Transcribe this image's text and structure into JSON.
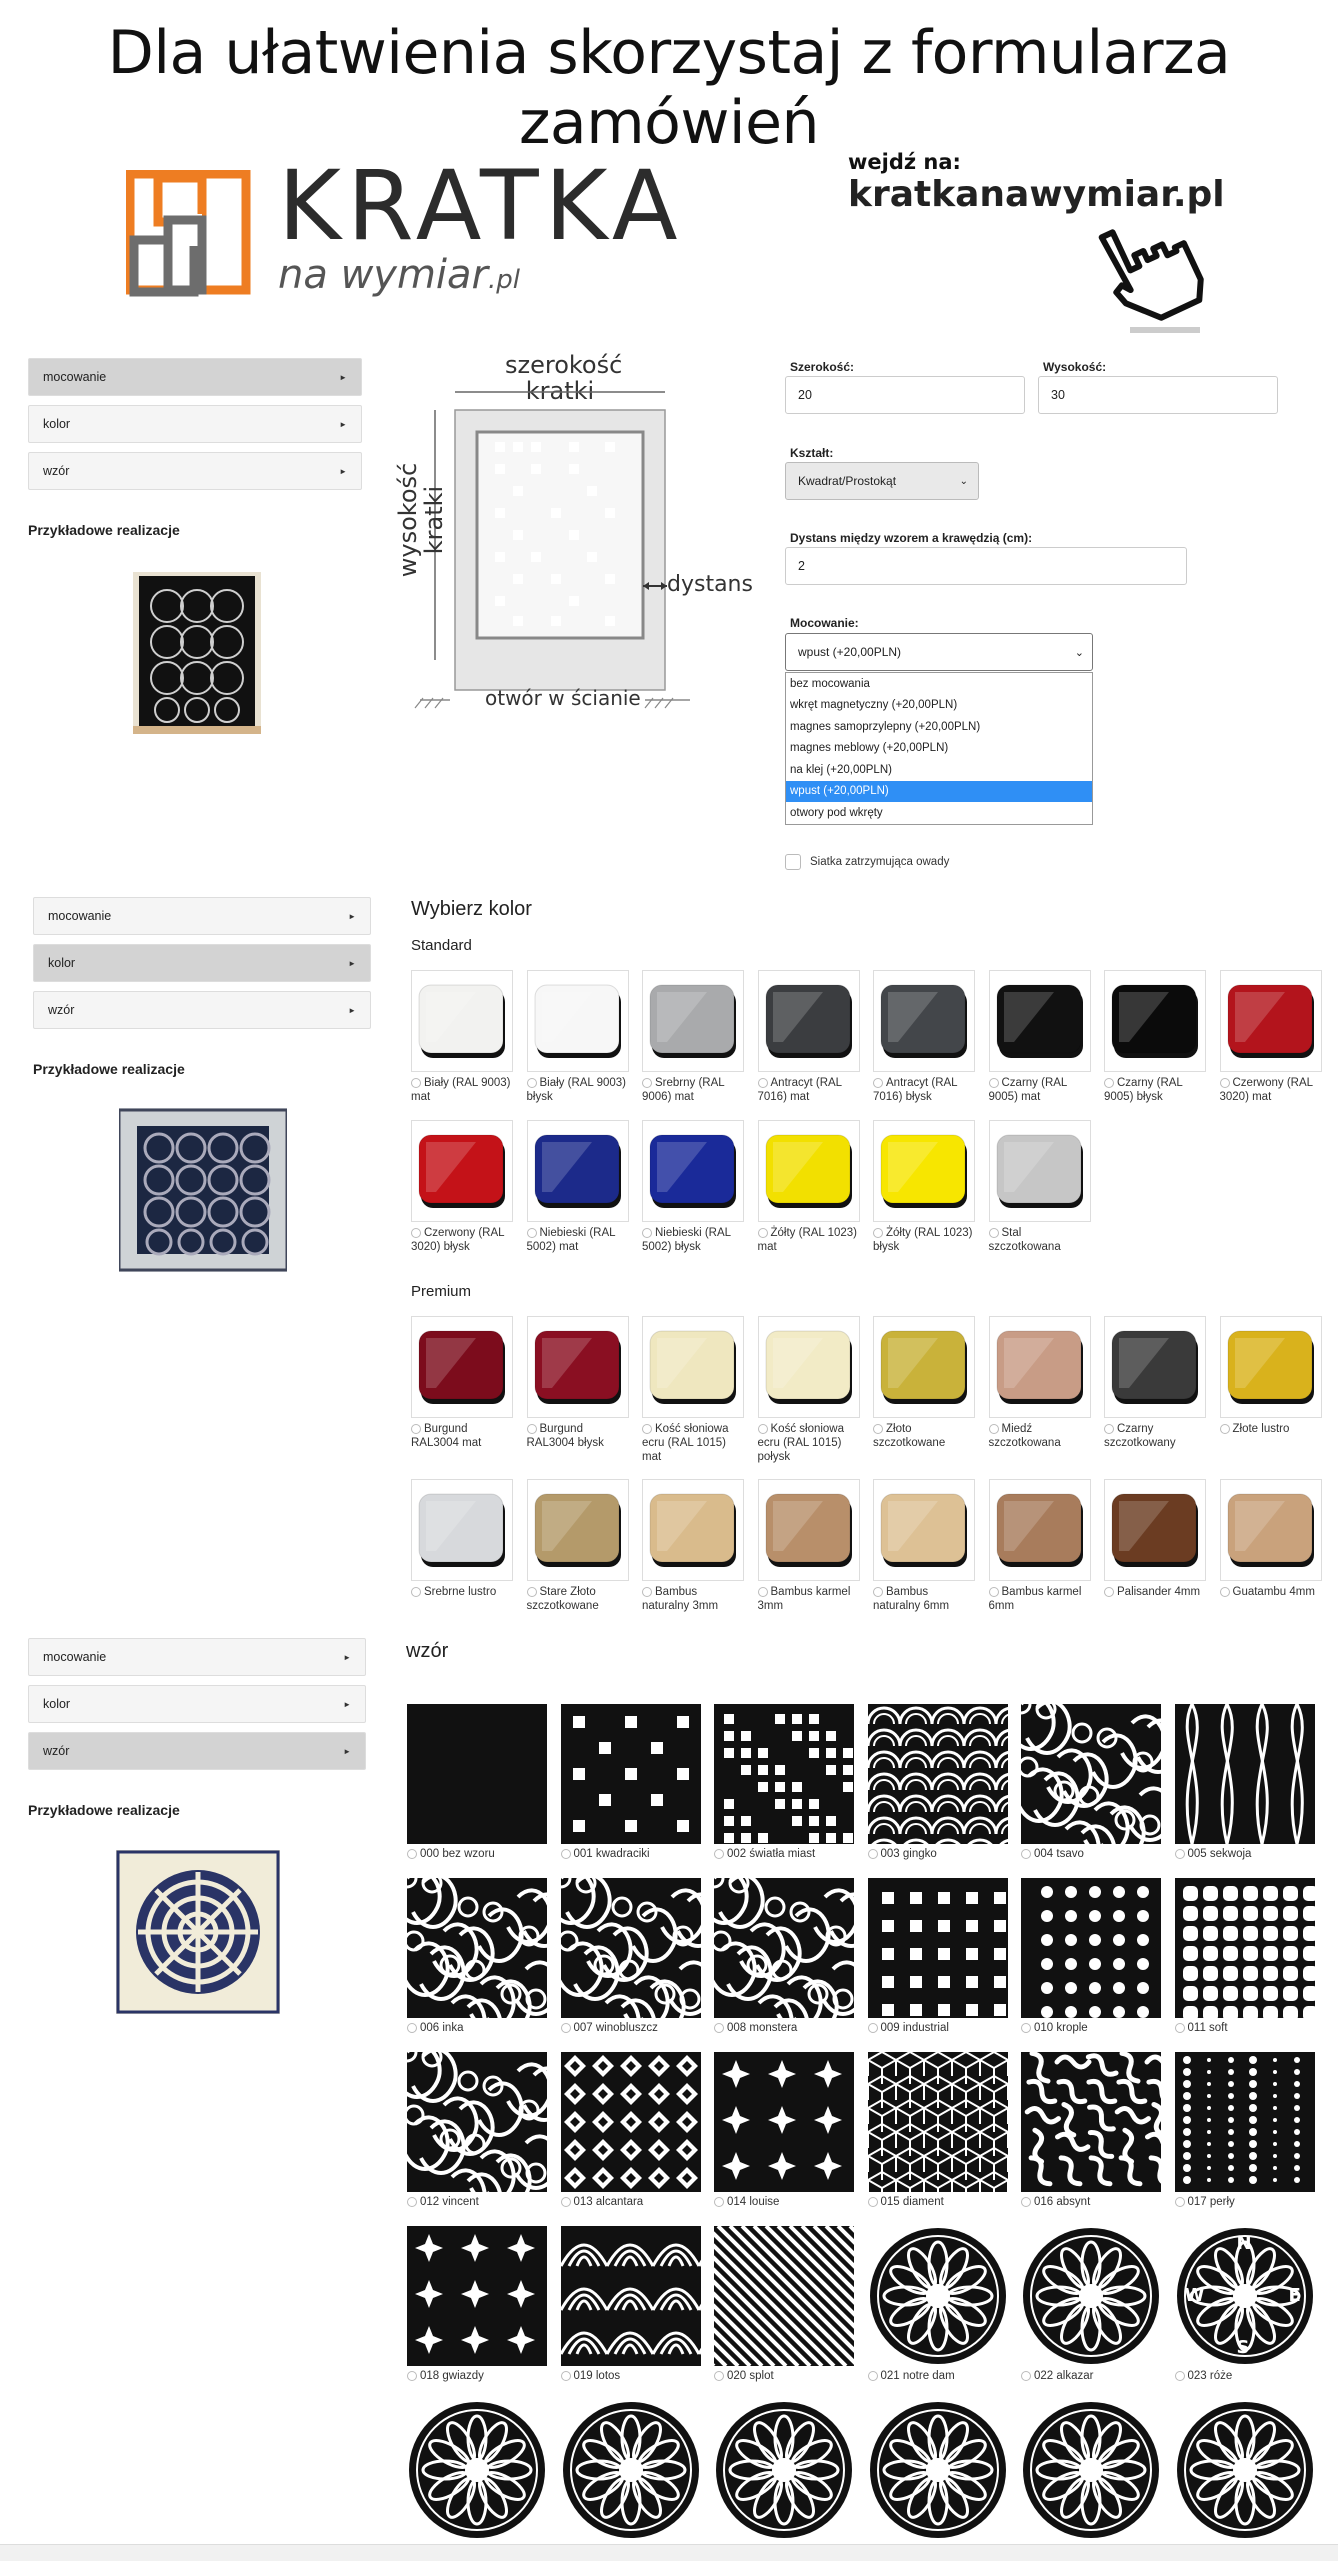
{
  "headline": "Dla ułatwienia skorzystaj z formularza zamówień",
  "logo": {
    "main": "KRATKA",
    "sub": "na wymiar",
    "tld": ".pl"
  },
  "promo": {
    "small": "wejdź na:",
    "domain": "kratkanawymiar.pl"
  },
  "sidebar": {
    "items": [
      "mocowanie",
      "kolor",
      "wzór"
    ],
    "heading": "Przykładowe realizacje"
  },
  "diagram": {
    "width_label_1": "szerokość",
    "width_label_2": "kratki",
    "height_label_1": "wysokość",
    "height_label_2": "kratki",
    "gap_label": "dystans",
    "wall_label": "otwór w ścianie"
  },
  "form": {
    "width_label": "Szerokość:",
    "width_value": "20",
    "height_label": "Wysokość:",
    "height_value": "30",
    "shape_label": "Kształt:",
    "shape_value": "Kwadrat/Prostokąt",
    "distance_label": "Dystans między wzorem a krawędzią (cm):",
    "distance_value": "2",
    "mount_label": "Mocowanie:",
    "mount_value": "wpust (+20,00PLN)",
    "mount_options": [
      "bez mocowania",
      "wkręt magnetyczny (+20,00PLN)",
      "magnes samoprzylepny (+20,00PLN)",
      "magnes meblowy (+20,00PLN)",
      "na klej (+20,00PLN)",
      "wpust (+20,00PLN)",
      "otwory pod wkręty"
    ],
    "mount_selected_index": 5,
    "net_label": "Siatka zatrzymująca owady"
  },
  "colors": {
    "title": "Wybierz kolor",
    "standard_title": "Standard",
    "premium_title": "Premium",
    "standard": [
      {
        "label": "Biały (RAL 9003) mat",
        "color": "#f2f2f0"
      },
      {
        "label": "Biały (RAL 9003) błysk",
        "color": "#f7f7f7"
      },
      {
        "label": "Srebrny (RAL 9006) mat",
        "color": "#a9aaac"
      },
      {
        "label": "Antracyt (RAL 7016) mat",
        "color": "#3b3d40"
      },
      {
        "label": "Antracyt (RAL 7016) błysk",
        "color": "#43464a"
      },
      {
        "label": "Czarny (RAL 9005) mat",
        "color": "#111111"
      },
      {
        "label": "Czarny (RAL 9005) błysk",
        "color": "#0b0b0b"
      },
      {
        "label": "Czerwony (RAL 3020) mat",
        "color": "#b3141c"
      },
      {
        "label": "Czerwony (RAL 3020) błysk",
        "color": "#c41218"
      },
      {
        "label": "Niebieski (RAL 5002) mat",
        "color": "#1c2a8a"
      },
      {
        "label": "Niebieski (RAL 5002) błysk",
        "color": "#1a2a99"
      },
      {
        "label": "Żółty (RAL 1023) mat",
        "color": "#f2e000"
      },
      {
        "label": "Żółty (RAL 1023) błysk",
        "color": "#f7e600"
      },
      {
        "label": "Stal szczotkowana",
        "color": "#c6c6c6"
      }
    ],
    "premium": [
      {
        "label": "Burgund RAL3004 mat",
        "color": "#7c0c1c"
      },
      {
        "label": "Burgund RAL3004 błysk",
        "color": "#8a0f22"
      },
      {
        "label": "Kość słoniowa ecru (RAL 1015) mat",
        "color": "#efe7bf"
      },
      {
        "label": "Kość słoniowa ecru (RAL 1015) połysk",
        "color": "#f2ebc6"
      },
      {
        "label": "Złoto szczotkowane",
        "color": "#c9b23a"
      },
      {
        "label": "Miedź szczotkowana",
        "color": "#c89c86"
      },
      {
        "label": "Czarny szczotkowany",
        "color": "#3a3a3a"
      },
      {
        "label": "Złote lustro",
        "color": "#d9b21c"
      },
      {
        "label": "Srebrne lustro",
        "color": "#d7d9dc"
      },
      {
        "label": "Stare Złoto szczotkowane",
        "color": "#b49a6a"
      },
      {
        "label": "Bambus naturalny 3mm",
        "color": "#d9bb8c"
      },
      {
        "label": "Bambus karmel 3mm",
        "color": "#b88f6a"
      },
      {
        "label": "Bambus naturalny 6mm",
        "color": "#ddc195"
      },
      {
        "label": "Bambus karmel 6mm",
        "color": "#a87c5c"
      },
      {
        "label": "Palisander 4mm",
        "color": "#6b3c22"
      },
      {
        "label": "Guatambu 4mm",
        "color": "#c9a27c"
      }
    ]
  },
  "patterns": {
    "title": "wzór",
    "items": [
      {
        "label": "000 bez wzoru",
        "kind": "solid"
      },
      {
        "label": "001 kwadraciki",
        "kind": "squares"
      },
      {
        "label": "002 światła miast",
        "kind": "city"
      },
      {
        "label": "003 gingko",
        "kind": "waves"
      },
      {
        "label": "004 tsavo",
        "kind": "floral"
      },
      {
        "label": "005 sekwoja",
        "kind": "leaves"
      },
      {
        "label": "006 inka",
        "kind": "floral"
      },
      {
        "label": "007 winobluszcz",
        "kind": "floral"
      },
      {
        "label": "008 monstera",
        "kind": "floral"
      },
      {
        "label": "009 industrial",
        "kind": "grid"
      },
      {
        "label": "010 krople",
        "kind": "dots"
      },
      {
        "label": "011 soft",
        "kind": "rounded"
      },
      {
        "label": "012 vincent",
        "kind": "floral"
      },
      {
        "label": "013 alcantara",
        "kind": "diamonds"
      },
      {
        "label": "014 louise",
        "kind": "stars"
      },
      {
        "label": "015 diament",
        "kind": "cubes"
      },
      {
        "label": "016 absynt",
        "kind": "squiggle"
      },
      {
        "label": "017 perły",
        "kind": "pearls"
      },
      {
        "label": "018 gwiazdy",
        "kind": "stars"
      },
      {
        "label": "019 lotos",
        "kind": "lotus"
      },
      {
        "label": "020 splot",
        "kind": "stripes"
      },
      {
        "label": "021 notre dam",
        "kind": "rosette"
      },
      {
        "label": "022 alkazar",
        "kind": "rosette"
      },
      {
        "label": "023 róże",
        "kind": "compass"
      },
      {
        "label": "",
        "kind": "rosette"
      },
      {
        "label": "",
        "kind": "rosette"
      },
      {
        "label": "",
        "kind": "rosette"
      },
      {
        "label": "",
        "kind": "rosette"
      },
      {
        "label": "",
        "kind": "rosette"
      },
      {
        "label": "",
        "kind": "rosette"
      }
    ]
  },
  "compass_letters": [
    "N",
    "E",
    "S",
    "W"
  ]
}
